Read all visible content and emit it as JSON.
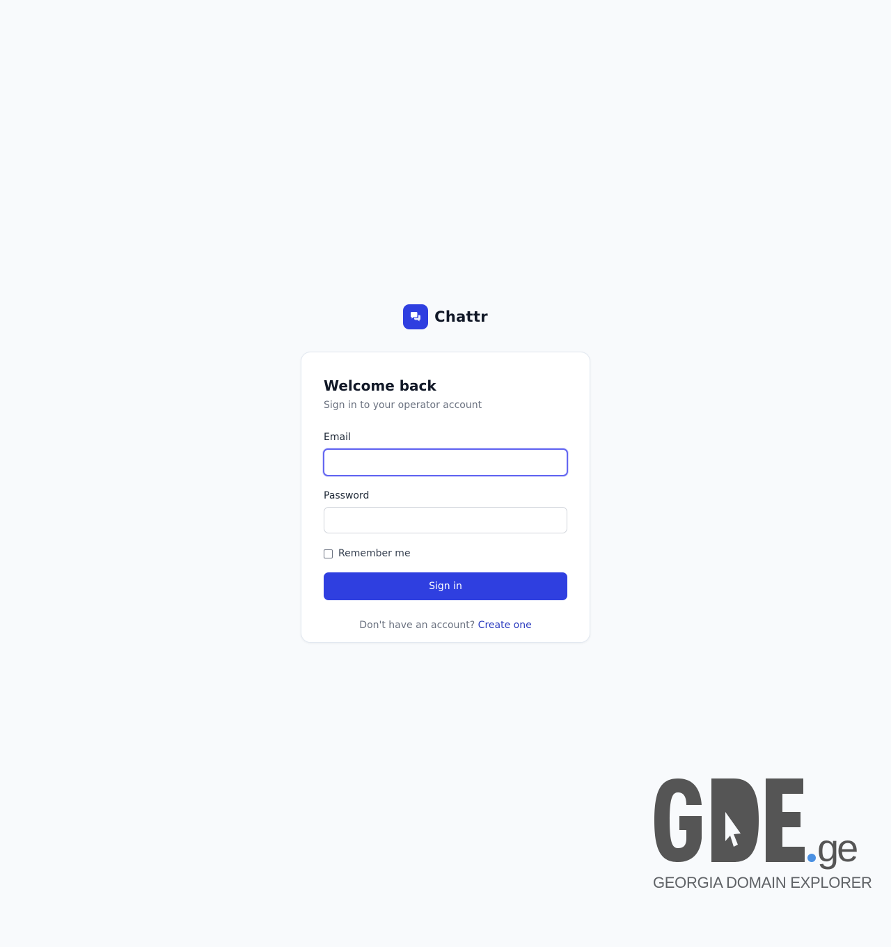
{
  "brand": {
    "name": "Chattr",
    "logo_icon": "chat-bubbles-icon",
    "color": "#2f3fe0"
  },
  "login": {
    "title": "Welcome back",
    "subtitle": "Sign in to your operator account",
    "email_label": "Email",
    "email_value": "",
    "password_label": "Password",
    "password_value": "",
    "remember_label": "Remember me",
    "remember_checked": false,
    "submit_label": "Sign in",
    "signup_prompt": "Don't have an account?",
    "signup_link": "Create one"
  },
  "watermark": {
    "logo_text": "GDE.ge",
    "caption": "GEORGIA DOMAIN EXPLORER",
    "dot_color": "#4a90e2"
  }
}
